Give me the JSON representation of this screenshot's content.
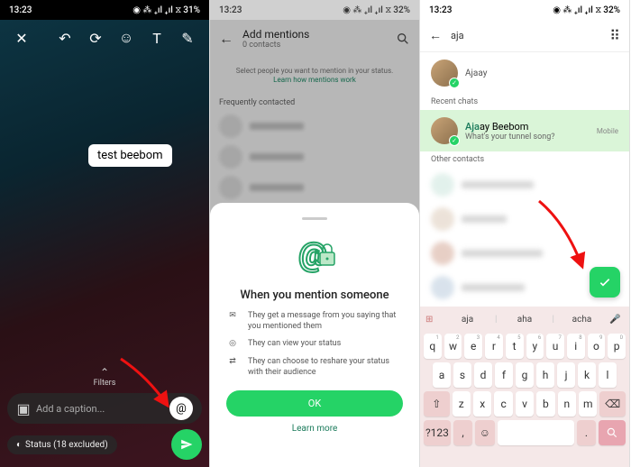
{
  "status_bar": {
    "time": "13:23",
    "battery1": "31%",
    "battery3": "32%"
  },
  "panel1": {
    "text_label": "test beebom",
    "filters": "Filters",
    "caption_placeholder": "Add a caption...",
    "status_text": "Status (18 excluded)"
  },
  "panel2": {
    "title": "Add mentions",
    "subtitle": "0 contacts",
    "hint": "Select people you want to mention in your status.",
    "hint_link": "Learn how mentions work",
    "freq_label": "Frequently contacted",
    "sheet_title": "When you mention someone",
    "bullet1": "They get a message from you saying that you mentioned them",
    "bullet2": "They can view your status",
    "bullet3": "They can choose to reshare your status with their audience",
    "ok": "OK",
    "learn_more": "Learn more"
  },
  "panel3": {
    "search_value": "aja",
    "contact_top": "Ajaay",
    "recent_label": "Recent chats",
    "hl_name_pre": "Aja",
    "hl_name_post": "ay Beebom",
    "hl_status": "What's your tunnel song?",
    "hl_tag": "Mobile",
    "other_label": "Other contacts",
    "suggestions": [
      "aja",
      "aha",
      "acha"
    ],
    "row1": [
      "q",
      "w",
      "e",
      "r",
      "t",
      "y",
      "u",
      "i",
      "o",
      "p"
    ],
    "nums1": [
      "1",
      "2",
      "3",
      "4",
      "5",
      "6",
      "7",
      "8",
      "9",
      "0"
    ],
    "row2": [
      "a",
      "s",
      "d",
      "f",
      "g",
      "h",
      "j",
      "k",
      "l"
    ],
    "row3": [
      "z",
      "x",
      "c",
      "v",
      "b",
      "n",
      "m"
    ],
    "sym_key": "?123",
    "comma": ",",
    "period": "."
  }
}
